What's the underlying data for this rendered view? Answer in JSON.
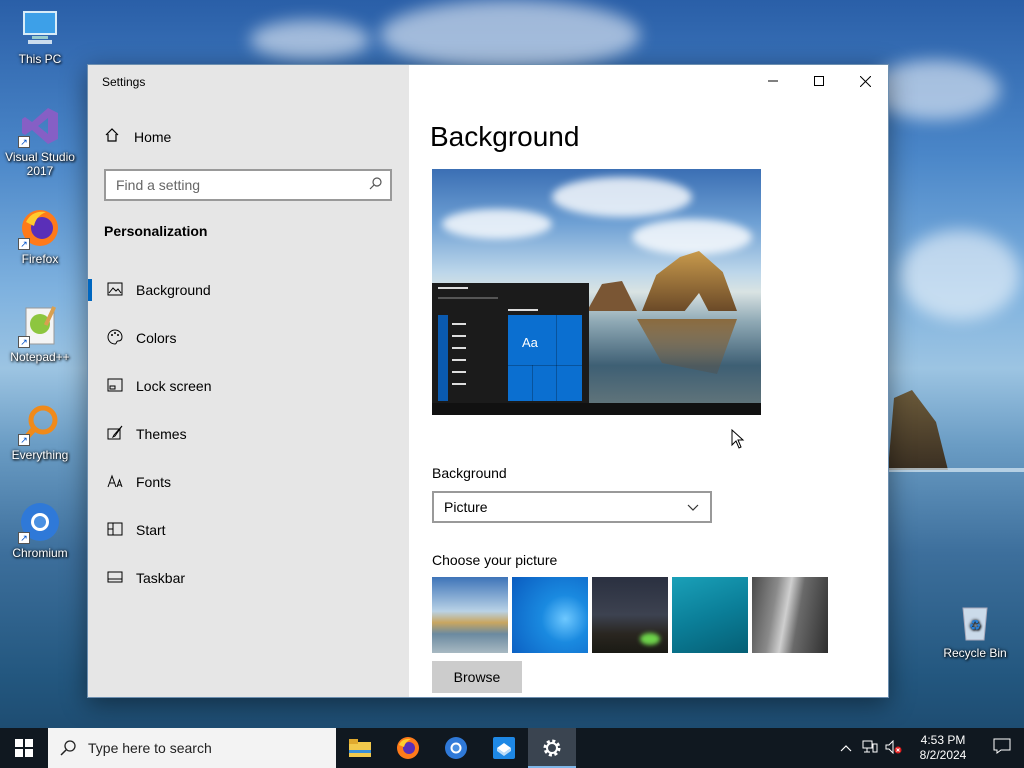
{
  "desktop": {
    "icons": [
      {
        "label": "This PC",
        "icon": "computer-icon"
      },
      {
        "label": "Visual Studio 2017",
        "icon": "visual-studio-icon"
      },
      {
        "label": "Firefox",
        "icon": "firefox-icon"
      },
      {
        "label": "Notepad++",
        "icon": "notepad-plus-plus-icon"
      },
      {
        "label": "Everything",
        "icon": "everything-search-icon"
      },
      {
        "label": "Chromium",
        "icon": "chromium-icon"
      },
      {
        "label": "Recycle Bin",
        "icon": "recycle-bin-icon"
      }
    ]
  },
  "window": {
    "title": "Settings",
    "controls": {
      "minimize": "—",
      "maximize": "☐",
      "close": "✕"
    }
  },
  "sidebar": {
    "home_label": "Home",
    "search_placeholder": "Find a setting",
    "section_title": "Personalization",
    "items": [
      {
        "label": "Background",
        "icon": "picture-icon",
        "active": true
      },
      {
        "label": "Colors",
        "icon": "palette-icon",
        "active": false
      },
      {
        "label": "Lock screen",
        "icon": "lock-screen-icon",
        "active": false
      },
      {
        "label": "Themes",
        "icon": "brush-icon",
        "active": false
      },
      {
        "label": "Fonts",
        "icon": "fonts-icon",
        "active": false
      },
      {
        "label": "Start",
        "icon": "start-menu-icon",
        "active": false
      },
      {
        "label": "Taskbar",
        "icon": "taskbar-icon",
        "active": false
      }
    ]
  },
  "main": {
    "title": "Background",
    "preview_tile_text": "Aa",
    "background_label": "Background",
    "background_value": "Picture",
    "choose_label": "Choose your picture",
    "browse_label": "Browse"
  },
  "taskbar": {
    "search_placeholder": "Type here to search",
    "apps": [
      "file-explorer-icon",
      "firefox-icon",
      "chromium-icon",
      "sandbox-app-icon",
      "settings-gear-icon"
    ],
    "time": "4:53 PM",
    "date": "8/2/2024"
  },
  "colors": {
    "accent": "#0067c0",
    "sidebar_bg": "#e6e6e6",
    "taskbar_bg": "#101820"
  }
}
